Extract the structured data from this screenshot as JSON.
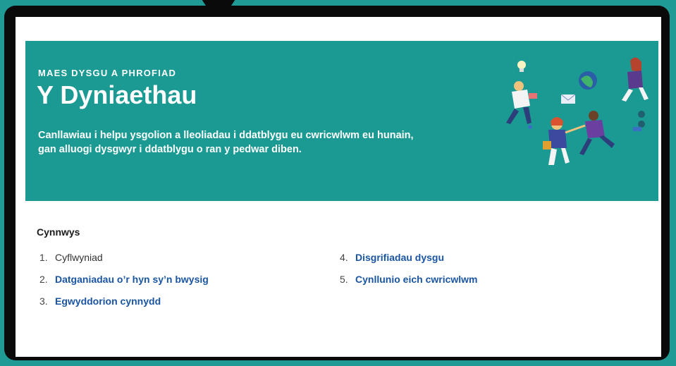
{
  "hero": {
    "eyebrow": "MAES DYSGU A PHROFIAD",
    "title": "Y Dyniaethau",
    "subtitle": "Canllawiau i helpu ysgolion a lleoliadau i ddatblygu eu cwricwlwm eu hunain, gan alluogi dysgwyr i ddatblygu o ran y pedwar diben."
  },
  "contents": {
    "heading": "Cynnwys",
    "items": [
      {
        "num": "1.",
        "label": "Cyflwyniad",
        "link": false
      },
      {
        "num": "2.",
        "label": "Datganiadau o’r hyn sy’n bwysig",
        "link": true
      },
      {
        "num": "3.",
        "label": "Egwyddorion cynnydd",
        "link": true
      },
      {
        "num": "4.",
        "label": "Disgrifiadau dysgu",
        "link": true
      },
      {
        "num": "5.",
        "label": "Cynllunio eich cwricwlwm",
        "link": true
      }
    ]
  },
  "colors": {
    "hero_bg": "#1b9993",
    "outer_bg": "#1f9a94",
    "link": "#1a55a3"
  }
}
